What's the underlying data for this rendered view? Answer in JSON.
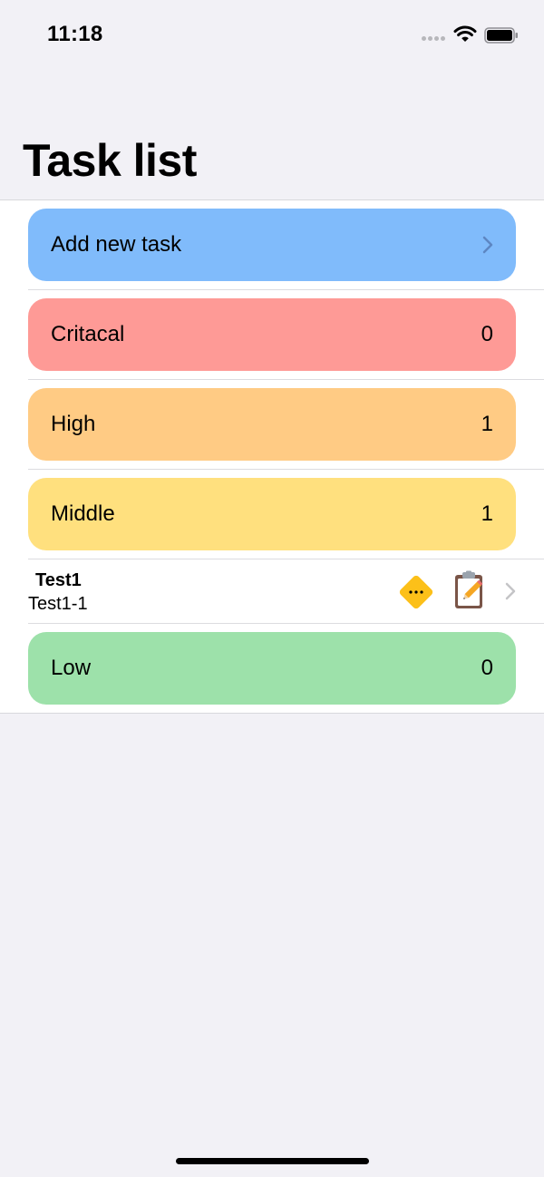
{
  "status_bar": {
    "time": "11:18"
  },
  "header": {
    "title": "Task list"
  },
  "list": {
    "add_task": {
      "label": "Add new task",
      "color": "#80bbfb"
    },
    "critical": {
      "label": "Critacal",
      "count": "0",
      "color": "#fe9a96"
    },
    "high": {
      "label": "High",
      "count": "1",
      "color": "#ffcb84"
    },
    "middle": {
      "label": "Middle",
      "count": "1",
      "color": "#ffe07e"
    },
    "task": {
      "title": "Test1",
      "subtitle": "Test1-1",
      "priority_icon": "warning-diamond-icon",
      "priority_color": "#fcc019",
      "edit_icon": "clipboard-pencil-icon"
    },
    "low": {
      "label": "Low",
      "count": "0",
      "color": "#9de1aa"
    }
  }
}
